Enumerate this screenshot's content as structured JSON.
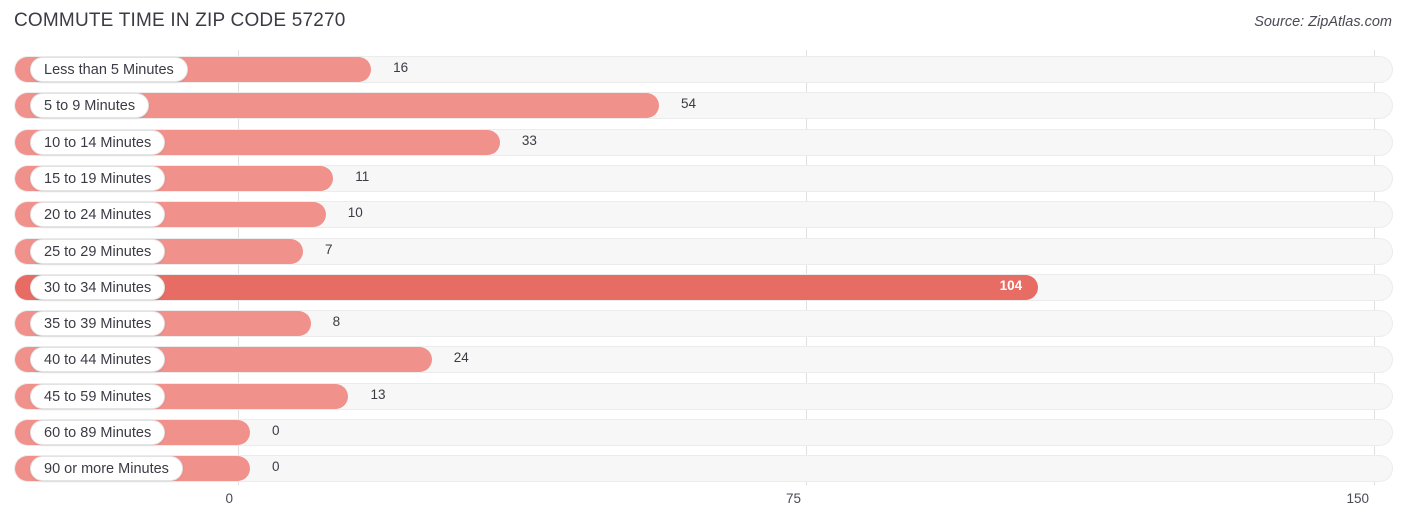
{
  "header": {
    "title": "COMMUTE TIME IN ZIP CODE 57270",
    "source": "Source: ZipAtlas.com"
  },
  "chart_data": {
    "type": "bar",
    "orientation": "horizontal",
    "title": "COMMUTE TIME IN ZIP CODE 57270",
    "xlabel": "",
    "ylabel": "",
    "xlim": [
      0,
      150
    ],
    "xticks": [
      0,
      75,
      150
    ],
    "xtick_labels": [
      "0",
      "75",
      "150"
    ],
    "grid": true,
    "legend": false,
    "highlight_category": "30 to 34 Minutes",
    "colors": {
      "bar": "#f0918c",
      "bar_highlight": "#e76c64",
      "track": "#f7f7f7",
      "gridline": "#e0e0e0",
      "text": "#3b3b45"
    },
    "categories": [
      "Less than 5 Minutes",
      "5 to 9 Minutes",
      "10 to 14 Minutes",
      "15 to 19 Minutes",
      "20 to 24 Minutes",
      "25 to 29 Minutes",
      "30 to 34 Minutes",
      "35 to 39 Minutes",
      "40 to 44 Minutes",
      "45 to 59 Minutes",
      "60 to 89 Minutes",
      "90 or more Minutes"
    ],
    "values": [
      16,
      54,
      33,
      11,
      10,
      7,
      104,
      8,
      24,
      13,
      0,
      0
    ],
    "value_labels": [
      "16",
      "54",
      "33",
      "11",
      "10",
      "7",
      "104",
      "8",
      "24",
      "13",
      "0",
      "0"
    ]
  }
}
